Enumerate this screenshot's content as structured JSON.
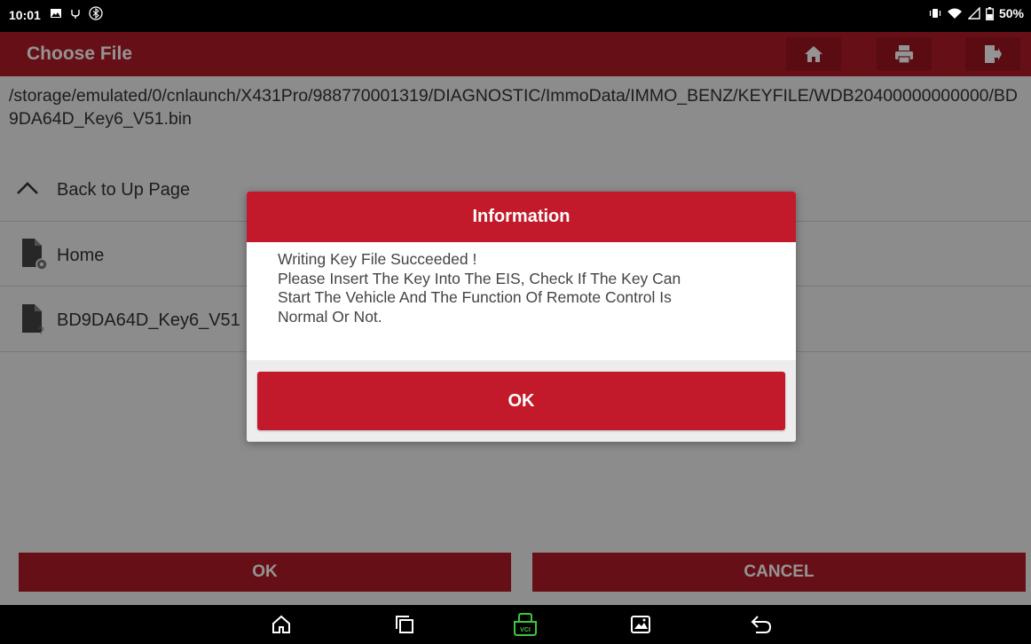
{
  "status_bar": {
    "time": "10:01",
    "battery": "50%",
    "left_icons": [
      "gallery-icon",
      "usb-debug-icon",
      "bluetooth-icon"
    ],
    "right_icons": [
      "vibrate-icon",
      "wifi-icon",
      "signal-icon",
      "battery-icon"
    ]
  },
  "title_bar": {
    "title": "Choose File",
    "buttons": [
      "home-icon",
      "print-icon",
      "exit-icon"
    ]
  },
  "path": "/storage/emulated/0/cnlaunch/X431Pro/988770001319/DIAGNOSTIC/ImmoData/IMMO_BENZ/KEYFILE/WDB20400000000000/BD9DA64D_Key6_V51.bin",
  "file_list": [
    {
      "label": "Back to Up Page",
      "icon": "chevron-up-icon"
    },
    {
      "label": "Home",
      "icon": "folder-settings-icon"
    },
    {
      "label": "BD9DA64D_Key6_V51",
      "icon": "file-unknown-icon"
    }
  ],
  "bottom_buttons": {
    "ok": "OK",
    "cancel": "CANCEL"
  },
  "dialog": {
    "title": "Information",
    "lines": [
      "Writing Key File Succeeded !",
      "Please Insert The Key Into The EIS, Check If The Key Can",
      "Start The Vehicle And The Function Of Remote Control Is",
      "Normal Or Not."
    ],
    "ok_label": "OK"
  },
  "nav_bar": {
    "icons": [
      "home-icon",
      "recents-icon",
      "vci-icon",
      "screenshot-icon",
      "back-icon"
    ]
  },
  "colors": {
    "primary": "#b21a26",
    "dialog_header": "#c21a2a",
    "vci_green": "#3ec63e"
  }
}
